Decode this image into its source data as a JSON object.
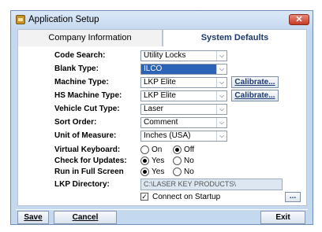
{
  "window": {
    "title": "Application Setup",
    "close_glyph": "✕"
  },
  "tabs": [
    {
      "label": "Company Information"
    },
    {
      "label": "System Defaults"
    }
  ],
  "form": {
    "code_search": {
      "label": "Code Search:",
      "value": "Utility Locks"
    },
    "blank_type": {
      "label": "Blank Type:",
      "value": "ILCO"
    },
    "machine_type": {
      "label": "Machine Type:",
      "value": "LKP Elite",
      "button": "Calibrate..."
    },
    "hs_machine_type": {
      "label": "HS Machine Type:",
      "value": "LKP Elite",
      "button": "Calibrate..."
    },
    "vehicle_cut_type": {
      "label": "Vehicle Cut Type:",
      "value": "Laser"
    },
    "sort_order": {
      "label": "Sort Order:",
      "value": "Comment"
    },
    "unit_of_measure": {
      "label": "Unit of Measure:",
      "value": "Inches (USA)"
    },
    "virtual_keyboard": {
      "label": "Virtual Keyboard:",
      "on": "On",
      "off": "Off",
      "selected": "Off"
    },
    "check_updates": {
      "label": "Check for Updates:",
      "yes": "Yes",
      "no": "No",
      "selected": "Yes"
    },
    "full_screen": {
      "label": "Run in Full Screen",
      "yes": "Yes",
      "no": "No",
      "selected": "Yes"
    },
    "lkp_directory": {
      "label": "LKP Directory:",
      "value": "C:\\LASER KEY PRODUCTS\\",
      "browse": "..."
    },
    "connect_on_startup": {
      "label": "Connect on Startup",
      "checked": true
    }
  },
  "footer": {
    "save": "Save",
    "cancel": "Cancel",
    "exit": "Exit"
  },
  "colors": {
    "window_bg": "#c4d8ef",
    "selected": "#2d63b7",
    "accent_text": "#1e3a6e"
  },
  "icons": [
    "app-icon",
    "close-icon",
    "dropdown-arrow-icon",
    "checkbox-icon"
  ]
}
